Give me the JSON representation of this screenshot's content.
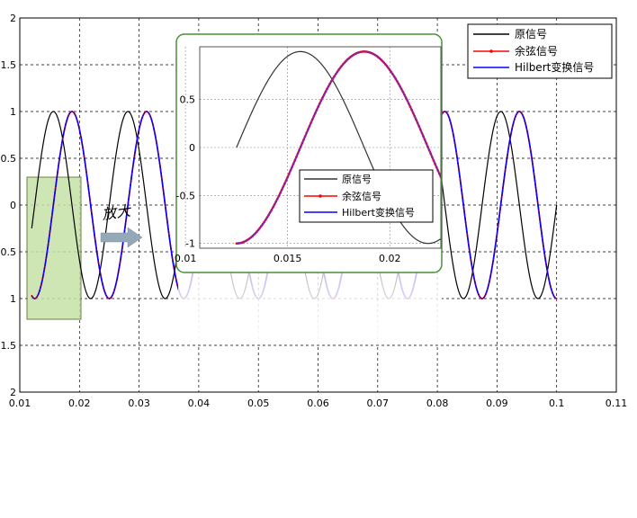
{
  "chart_data": [
    {
      "type": "line",
      "title": "",
      "xlabel": "",
      "ylabel": "",
      "xlim": [
        0.01,
        0.11
      ],
      "ylim": [
        -2,
        2
      ],
      "grid": true,
      "grid_style": "dashed",
      "x_ticks": [
        "0.01",
        "0.02",
        "0.03",
        "0.04",
        "0.05",
        "0.06",
        "0.07",
        "0.08",
        "0.09",
        "0.1",
        "0.11"
      ],
      "y_ticks": [
        "2",
        "1.5",
        "1",
        "0.5",
        "0",
        "0.5",
        "1",
        "1.5",
        "2"
      ],
      "x_range": [
        0.012,
        0.1
      ],
      "series": [
        {
          "name": "原信号",
          "color": "#000000",
          "function": "cos",
          "frequency_hz": 80,
          "phase_deg": -90,
          "marker": "none"
        },
        {
          "name": "余弦信号",
          "color": "#ff0000",
          "function": "cos",
          "frequency_hz": 80,
          "phase_deg": -180,
          "marker": "dot"
        },
        {
          "name": "Hilbert变换信号",
          "color": "#0000ff",
          "function": "cos",
          "frequency_hz": 80,
          "phase_deg": -180,
          "marker": "none"
        }
      ],
      "legend_placement": "top-right"
    },
    {
      "type": "line",
      "title": "",
      "xlim": [
        0.0107,
        0.0225
      ],
      "ylim": [
        -1.05,
        1.05
      ],
      "grid": true,
      "x_ticks": [
        "0.01",
        "0.015",
        "0.02"
      ],
      "y_ticks": [
        "0.5",
        "0",
        "-0.5",
        "-1"
      ],
      "x_range_series": [
        0.0125,
        0.0225
      ],
      "series_names": [
        "原信号",
        "余弦信号",
        "Hilbert变换信号"
      ],
      "legend_placement": "bottom-right"
    }
  ],
  "annotations": {
    "zoom_label": "放大",
    "highlight_region_color": "#c6e2a8",
    "zoom_frame_color": "#4a8f3a",
    "arrow_color": "#94a8b8"
  }
}
